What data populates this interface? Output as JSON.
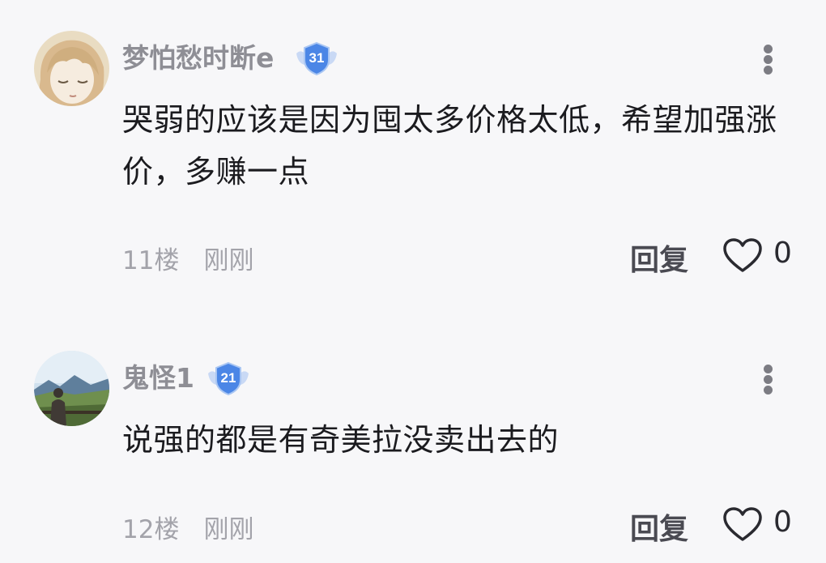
{
  "comments": [
    {
      "username": "梦怕愁时断e",
      "level": "31",
      "content": "哭弱的应该是因为囤太多价格太低，希望加强涨价，多赚一点",
      "floor": "11楼",
      "time": "刚刚",
      "reply_label": "回复",
      "like_count": "0"
    },
    {
      "username": "鬼怪1",
      "level": "21",
      "content": "说强的都是有奇美拉没卖出去的",
      "floor": "12楼",
      "time": "刚刚",
      "reply_label": "回复",
      "like_count": "0"
    }
  ],
  "colors": {
    "badge_blue": "#4b86e6",
    "username_gray": "#8e8e95",
    "text_dark": "#1b1b1f"
  },
  "icons": {
    "more": "more-vertical-icon",
    "like": "heart-outline-icon",
    "badge": "level-shield-icon"
  }
}
